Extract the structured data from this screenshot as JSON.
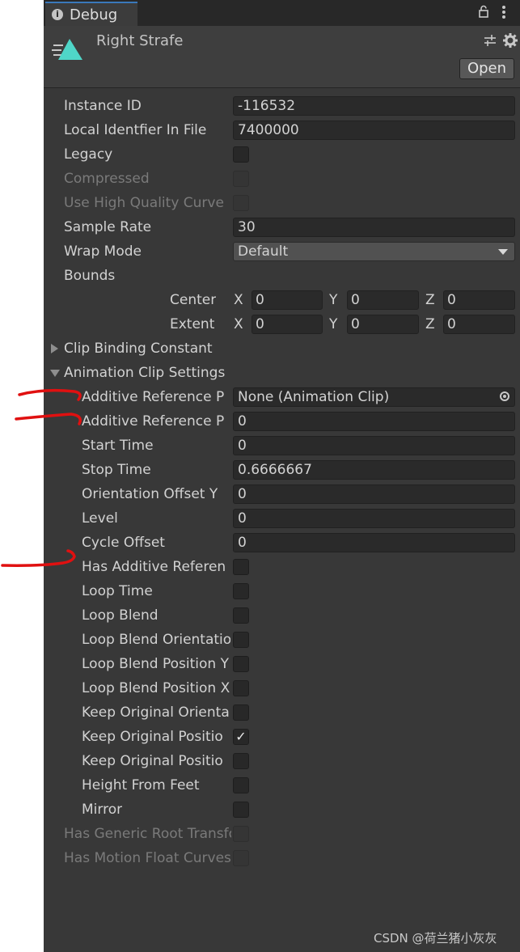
{
  "tab": {
    "label": "Debug"
  },
  "header": {
    "title": "Right Strafe",
    "open_label": "Open"
  },
  "fields": {
    "instance_id": {
      "label": "Instance ID",
      "value": "-116532"
    },
    "local_identifier": {
      "label": "Local Identfier In File",
      "value": "7400000"
    },
    "legacy": {
      "label": "Legacy",
      "checked": false
    },
    "compressed": {
      "label": "Compressed",
      "checked": false
    },
    "use_high_quality_curve": {
      "label": "Use High Quality Curve",
      "checked": false
    },
    "sample_rate": {
      "label": "Sample Rate",
      "value": "30"
    },
    "wrap_mode": {
      "label": "Wrap Mode",
      "value": "Default"
    },
    "bounds": {
      "label": "Bounds",
      "center": {
        "label": "Center",
        "x_label": "X",
        "x": "0",
        "y_label": "Y",
        "y": "0",
        "z_label": "Z",
        "z": "0"
      },
      "extent": {
        "label": "Extent",
        "x_label": "X",
        "x": "0",
        "y_label": "Y",
        "y": "0",
        "z_label": "Z",
        "z": "0"
      }
    }
  },
  "clip_binding_constant": {
    "label": "Clip Binding Constant"
  },
  "animation_clip_settings": {
    "label": "Animation Clip Settings",
    "additive_reference_pose_clip": {
      "label": "Additive Reference P",
      "value": "None (Animation Clip)"
    },
    "additive_reference_pose_time": {
      "label": "Additive Reference P",
      "value": "0"
    },
    "start_time": {
      "label": "Start Time",
      "value": "0"
    },
    "stop_time": {
      "label": "Stop Time",
      "value": "0.6666667"
    },
    "orientation_offset_y": {
      "label": "Orientation Offset Y",
      "value": "0"
    },
    "level": {
      "label": "Level",
      "value": "0"
    },
    "cycle_offset": {
      "label": "Cycle Offset",
      "value": "0"
    },
    "has_additive_reference_pose": {
      "label": "Has Additive Referen",
      "checked": false
    },
    "loop_time": {
      "label": "Loop Time",
      "checked": false
    },
    "loop_blend": {
      "label": "Loop Blend",
      "checked": false
    },
    "loop_blend_orientation": {
      "label": "Loop Blend Orientatio",
      "checked": false
    },
    "loop_blend_position_y": {
      "label": "Loop Blend Position Y",
      "checked": false
    },
    "loop_blend_position_xz": {
      "label": "Loop Blend Position X",
      "checked": false
    },
    "keep_original_orientation": {
      "label": "Keep Original Orienta",
      "checked": false
    },
    "keep_original_position_y": {
      "label": "Keep Original Positio",
      "checked": true,
      "mark": "✓"
    },
    "keep_original_position_xz": {
      "label": "Keep Original Positio",
      "checked": false
    },
    "height_from_feet": {
      "label": "Height From Feet",
      "checked": false
    },
    "mirror": {
      "label": "Mirror",
      "checked": false
    }
  },
  "has_generic_root_transform": {
    "label": "Has Generic Root Transform",
    "checked": false
  },
  "has_motion_float_curves": {
    "label": "Has Motion Float Curves",
    "checked": false
  },
  "watermark": "CSDN @荷兰猪小灰灰",
  "colors": {
    "panel": "#383838",
    "accent_tab": "#3a79bb",
    "clip_icon": "#4fd6c8",
    "annotation": "#e01010"
  }
}
